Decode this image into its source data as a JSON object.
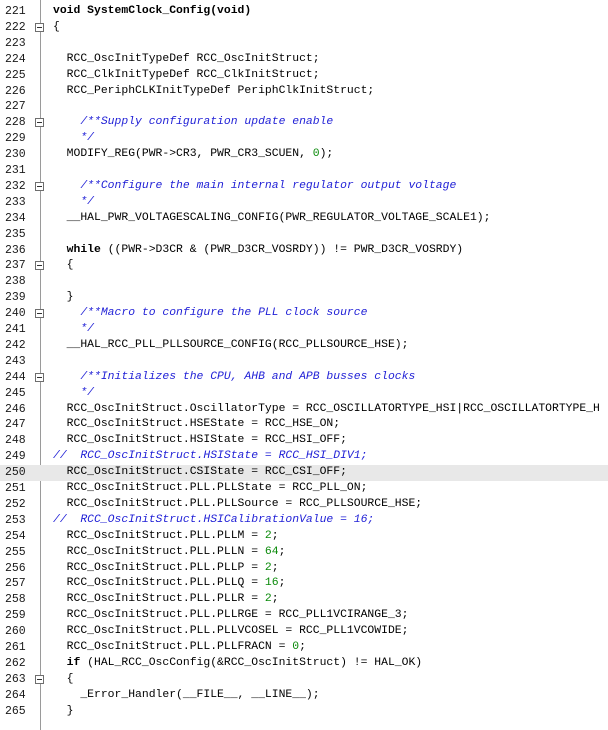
{
  "colors": {
    "background": "#ffffff",
    "highlight_line": "#e8e8e8",
    "comment": "#1f1fd6",
    "number": "#0a8a0a",
    "text": "#000000"
  },
  "icons": {
    "fold_marker": "collapse-box-icon"
  },
  "lines": [
    {
      "n": "221",
      "fold": false,
      "hl": false,
      "segs": [
        {
          "t": "void SystemClock_Config(void)",
          "c": "kw"
        }
      ]
    },
    {
      "n": "222",
      "fold": true,
      "hl": false,
      "segs": [
        {
          "t": "{",
          "c": ""
        }
      ]
    },
    {
      "n": "223",
      "fold": false,
      "hl": false,
      "segs": []
    },
    {
      "n": "224",
      "fold": false,
      "hl": false,
      "segs": [
        {
          "t": "  RCC_OscInitTypeDef RCC_OscInitStruct;",
          "c": ""
        }
      ]
    },
    {
      "n": "225",
      "fold": false,
      "hl": false,
      "segs": [
        {
          "t": "  RCC_ClkInitTypeDef RCC_ClkInitStruct;",
          "c": ""
        }
      ]
    },
    {
      "n": "226",
      "fold": false,
      "hl": false,
      "segs": [
        {
          "t": "  RCC_PeriphCLKInitTypeDef PeriphClkInitStruct;",
          "c": ""
        }
      ]
    },
    {
      "n": "227",
      "fold": false,
      "hl": false,
      "segs": []
    },
    {
      "n": "228",
      "fold": true,
      "hl": false,
      "segs": [
        {
          "t": "    /**Supply configuration update enable",
          "c": "cm"
        }
      ]
    },
    {
      "n": "229",
      "fold": false,
      "hl": false,
      "segs": [
        {
          "t": "    */",
          "c": "cm"
        }
      ]
    },
    {
      "n": "230",
      "fold": false,
      "hl": false,
      "segs": [
        {
          "t": "  MODIFY_REG(PWR->CR3, PWR_CR3_SCUEN, ",
          "c": ""
        },
        {
          "t": "0",
          "c": "num"
        },
        {
          "t": ");",
          "c": ""
        }
      ]
    },
    {
      "n": "231",
      "fold": false,
      "hl": false,
      "segs": []
    },
    {
      "n": "232",
      "fold": true,
      "hl": false,
      "segs": [
        {
          "t": "    /**Configure the main internal regulator output voltage",
          "c": "cm"
        }
      ]
    },
    {
      "n": "233",
      "fold": false,
      "hl": false,
      "segs": [
        {
          "t": "    */",
          "c": "cm"
        }
      ]
    },
    {
      "n": "234",
      "fold": false,
      "hl": false,
      "segs": [
        {
          "t": "  __HAL_PWR_VOLTAGESCALING_CONFIG(PWR_REGULATOR_VOLTAGE_SCALE1);",
          "c": ""
        }
      ]
    },
    {
      "n": "235",
      "fold": false,
      "hl": false,
      "segs": []
    },
    {
      "n": "236",
      "fold": false,
      "hl": false,
      "segs": [
        {
          "t": "  ",
          "c": ""
        },
        {
          "t": "while",
          "c": "kw"
        },
        {
          "t": " ((PWR->D3CR & (PWR_D3CR_VOSRDY)) != PWR_D3CR_VOSRDY)",
          "c": ""
        }
      ]
    },
    {
      "n": "237",
      "fold": true,
      "hl": false,
      "segs": [
        {
          "t": "  {",
          "c": ""
        }
      ]
    },
    {
      "n": "238",
      "fold": false,
      "hl": false,
      "segs": []
    },
    {
      "n": "239",
      "fold": false,
      "hl": false,
      "segs": [
        {
          "t": "  }",
          "c": ""
        }
      ]
    },
    {
      "n": "240",
      "fold": true,
      "hl": false,
      "segs": [
        {
          "t": "    /**Macro to configure the PLL clock source",
          "c": "cm"
        }
      ]
    },
    {
      "n": "241",
      "fold": false,
      "hl": false,
      "segs": [
        {
          "t": "    */",
          "c": "cm"
        }
      ]
    },
    {
      "n": "242",
      "fold": false,
      "hl": false,
      "segs": [
        {
          "t": "  __HAL_RCC_PLL_PLLSOURCE_CONFIG(RCC_PLLSOURCE_HSE);",
          "c": ""
        }
      ]
    },
    {
      "n": "243",
      "fold": false,
      "hl": false,
      "segs": []
    },
    {
      "n": "244",
      "fold": true,
      "hl": false,
      "segs": [
        {
          "t": "    /**Initializes the CPU, AHB and APB busses clocks",
          "c": "cm"
        }
      ]
    },
    {
      "n": "245",
      "fold": false,
      "hl": false,
      "segs": [
        {
          "t": "    */",
          "c": "cm"
        }
      ]
    },
    {
      "n": "246",
      "fold": false,
      "hl": false,
      "segs": [
        {
          "t": "  RCC_OscInitStruct.OscillatorType = RCC_OSCILLATORTYPE_HSI|RCC_OSCILLATORTYPE_H",
          "c": ""
        }
      ]
    },
    {
      "n": "247",
      "fold": false,
      "hl": false,
      "segs": [
        {
          "t": "  RCC_OscInitStruct.HSEState = RCC_HSE_ON;",
          "c": ""
        }
      ]
    },
    {
      "n": "248",
      "fold": false,
      "hl": false,
      "segs": [
        {
          "t": "  RCC_OscInitStruct.HSIState = RCC_HSI_OFF;",
          "c": ""
        }
      ]
    },
    {
      "n": "249",
      "fold": false,
      "hl": false,
      "segs": [
        {
          "t": "//  RCC_OscInitStruct.HSIState = RCC_HSI_DIV1;",
          "c": "cm"
        }
      ]
    },
    {
      "n": "250",
      "fold": false,
      "hl": true,
      "segs": [
        {
          "t": "  RCC_OscInitStruct.CSIState = RCC_CSI_OFF;",
          "c": ""
        }
      ]
    },
    {
      "n": "251",
      "fold": false,
      "hl": false,
      "segs": [
        {
          "t": "  RCC_OscInitStruct.PLL.PLLState = RCC_PLL_ON;",
          "c": ""
        }
      ]
    },
    {
      "n": "252",
      "fold": false,
      "hl": false,
      "segs": [
        {
          "t": "  RCC_OscInitStruct.PLL.PLLSource = RCC_PLLSOURCE_HSE;",
          "c": ""
        }
      ]
    },
    {
      "n": "253",
      "fold": false,
      "hl": false,
      "segs": [
        {
          "t": "//  RCC_OscInitStruct.HSICalibrationValue = 16;",
          "c": "cm"
        }
      ]
    },
    {
      "n": "254",
      "fold": false,
      "hl": false,
      "segs": [
        {
          "t": "  RCC_OscInitStruct.PLL.PLLM = ",
          "c": ""
        },
        {
          "t": "2",
          "c": "num"
        },
        {
          "t": ";",
          "c": ""
        }
      ]
    },
    {
      "n": "255",
      "fold": false,
      "hl": false,
      "segs": [
        {
          "t": "  RCC_OscInitStruct.PLL.PLLN = ",
          "c": ""
        },
        {
          "t": "64",
          "c": "num"
        },
        {
          "t": ";",
          "c": ""
        }
      ]
    },
    {
      "n": "256",
      "fold": false,
      "hl": false,
      "segs": [
        {
          "t": "  RCC_OscInitStruct.PLL.PLLP = ",
          "c": ""
        },
        {
          "t": "2",
          "c": "num"
        },
        {
          "t": ";",
          "c": ""
        }
      ]
    },
    {
      "n": "257",
      "fold": false,
      "hl": false,
      "segs": [
        {
          "t": "  RCC_OscInitStruct.PLL.PLLQ = ",
          "c": ""
        },
        {
          "t": "16",
          "c": "num"
        },
        {
          "t": ";",
          "c": ""
        }
      ]
    },
    {
      "n": "258",
      "fold": false,
      "hl": false,
      "segs": [
        {
          "t": "  RCC_OscInitStruct.PLL.PLLR = ",
          "c": ""
        },
        {
          "t": "2",
          "c": "num"
        },
        {
          "t": ";",
          "c": ""
        }
      ]
    },
    {
      "n": "259",
      "fold": false,
      "hl": false,
      "segs": [
        {
          "t": "  RCC_OscInitStruct.PLL.PLLRGE = RCC_PLL1VCIRANGE_3;",
          "c": ""
        }
      ]
    },
    {
      "n": "260",
      "fold": false,
      "hl": false,
      "segs": [
        {
          "t": "  RCC_OscInitStruct.PLL.PLLVCOSEL = RCC_PLL1VCOWIDE;",
          "c": ""
        }
      ]
    },
    {
      "n": "261",
      "fold": false,
      "hl": false,
      "segs": [
        {
          "t": "  RCC_OscInitStruct.PLL.PLLFRACN = ",
          "c": ""
        },
        {
          "t": "0",
          "c": "num"
        },
        {
          "t": ";",
          "c": ""
        }
      ]
    },
    {
      "n": "262",
      "fold": false,
      "hl": false,
      "segs": [
        {
          "t": "  ",
          "c": ""
        },
        {
          "t": "if",
          "c": "kw"
        },
        {
          "t": " (HAL_RCC_OscConfig(&RCC_OscInitStruct) != HAL_OK)",
          "c": ""
        }
      ]
    },
    {
      "n": "263",
      "fold": true,
      "hl": false,
      "segs": [
        {
          "t": "  {",
          "c": ""
        }
      ]
    },
    {
      "n": "264",
      "fold": false,
      "hl": false,
      "segs": [
        {
          "t": "    _Error_Handler(__FILE__, __LINE__);",
          "c": ""
        }
      ]
    },
    {
      "n": "265",
      "fold": false,
      "hl": false,
      "segs": [
        {
          "t": "  }",
          "c": ""
        }
      ]
    }
  ]
}
